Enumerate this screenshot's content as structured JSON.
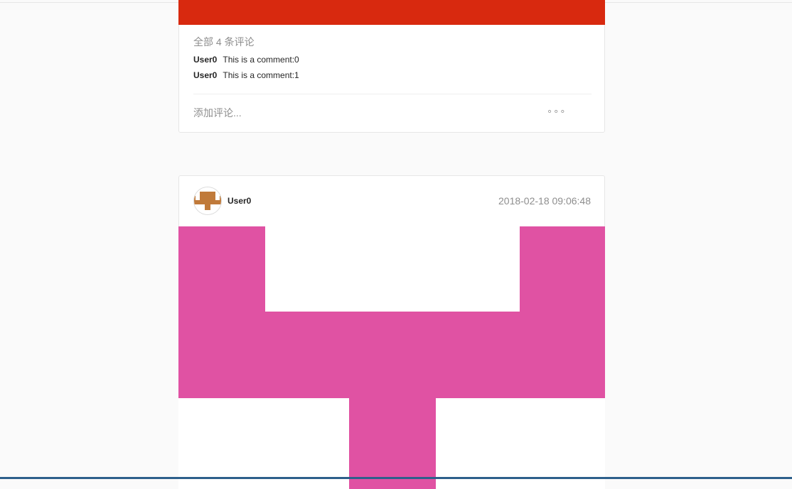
{
  "post1": {
    "image_color": "#d8290f",
    "comment_count": "全部 4 条评论",
    "comments": [
      {
        "user": "User0",
        "text": "This is a comment:0"
      },
      {
        "user": "User0",
        "text": "This is a comment:1"
      }
    ],
    "add_comment_placeholder": "添加评论...",
    "more_label": "∘∘∘"
  },
  "post2": {
    "username": "User0",
    "timestamp": "2018-02-18 09:06:48",
    "avatar_color": "#c07a3a",
    "image_color": "#e052a3"
  }
}
